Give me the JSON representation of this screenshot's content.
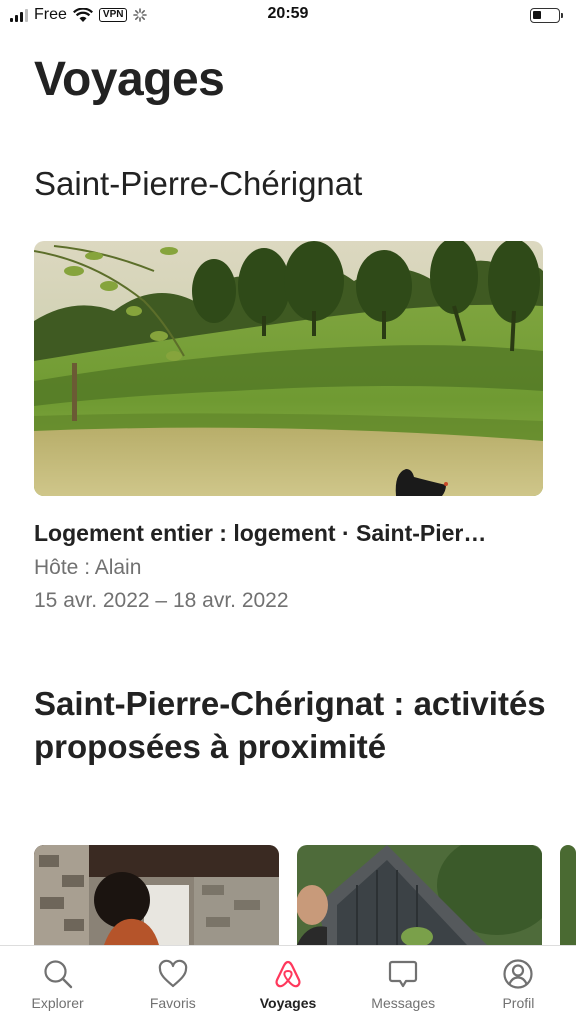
{
  "status_bar": {
    "carrier": "Free",
    "vpn": "VPN",
    "time": "20:59"
  },
  "page_title": "Voyages",
  "trip": {
    "heading": "Saint-Pierre-Chérignat",
    "listing_title": "Logement entier : logement · Saint-Pier…",
    "host": "Hôte : Alain",
    "dates": "15 avr. 2022 – 18 avr. 2022"
  },
  "activities": {
    "heading": "Saint-Pierre-Chérignat : activités proposées à proximité"
  },
  "tabs": [
    {
      "label": "Explorer",
      "icon": "search-icon",
      "active": false
    },
    {
      "label": "Favoris",
      "icon": "heart-icon",
      "active": false
    },
    {
      "label": "Voyages",
      "icon": "airbnb-logo-icon",
      "active": true
    },
    {
      "label": "Messages",
      "icon": "message-icon",
      "active": false
    },
    {
      "label": "Profil",
      "icon": "profile-icon",
      "active": false
    }
  ],
  "colors": {
    "accent": "#FF385C",
    "text": "#222222",
    "muted": "#717171"
  }
}
